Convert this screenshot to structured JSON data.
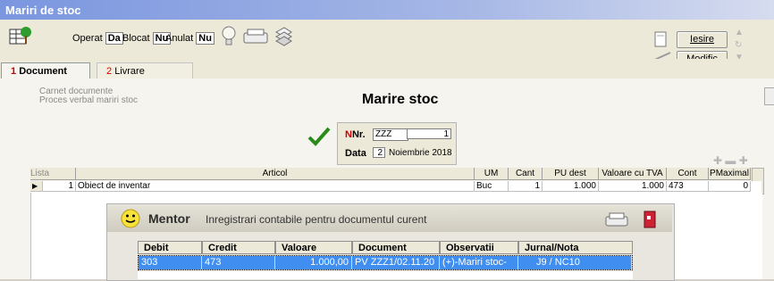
{
  "window": {
    "title": "Mariri de stoc"
  },
  "toolbar": {
    "operat_label": "Operat",
    "operat_value": "Da",
    "blocat_label": "Blocat",
    "blocat_value": "Nu",
    "anulat_label": "Anulat",
    "anulat_value": "Nu",
    "iesire_label": "Iesire",
    "modific_label": "Modific"
  },
  "tabs": [
    {
      "num": "1",
      "label": "Document"
    },
    {
      "num": "2",
      "label": "Livrare"
    }
  ],
  "document": {
    "links": [
      "Carnet documente",
      "Proces verbal mariri stoc"
    ],
    "heading": "Marire stoc",
    "nr_label": "Nr.",
    "nr_series": "ZZZ",
    "nr_value": "1",
    "data_label": "Data",
    "data_day": "2",
    "data_month_year": "Noiembrie 2018"
  },
  "grid": {
    "columns": [
      "Lista",
      "Articol",
      "UM",
      "Cant",
      "PU dest",
      "Valoare cu TVA",
      "Cont",
      "PMaximal"
    ],
    "rows": [
      {
        "nr": "1",
        "articol": "Obiect de inventar",
        "um": "Buc",
        "cant": "1",
        "pu_dest": "1.000",
        "valoare": "1.000",
        "cont": "473",
        "pmaximal": "0"
      }
    ]
  },
  "mentor": {
    "brand": "Mentor",
    "title": "Inregistrari contabile pentru documentul curent",
    "columns": [
      "Debit",
      "Credit",
      "Valoare",
      "Document",
      "Observatii",
      "Jurnal/Nota"
    ],
    "rows": [
      {
        "debit": "303",
        "credit": "473",
        "valoare": "1.000,00",
        "document": "PV ZZZ1/02.11.20",
        "observatii": "(+)-Mariri stoc-",
        "jurnal": "J9 / NC10"
      }
    ]
  },
  "colors": {
    "accent": "#3f8ef0",
    "tab_number": "#d00000",
    "title_bar": "#7a96df"
  }
}
